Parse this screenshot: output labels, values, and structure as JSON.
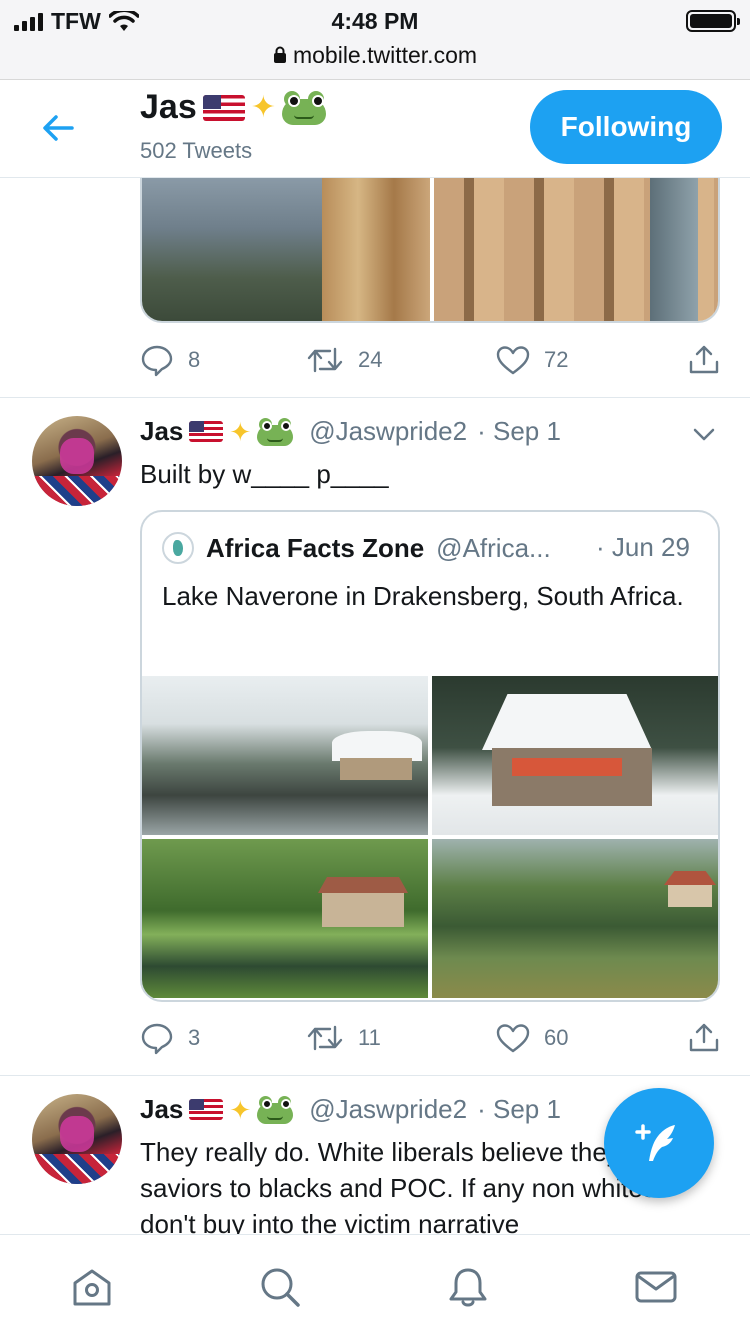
{
  "status_bar": {
    "carrier": "TFW",
    "time": "4:48 PM",
    "url": "mobile.twitter.com"
  },
  "header": {
    "name": "Jas",
    "tweet_count": "502 Tweets",
    "follow_button": "Following"
  },
  "tweets": [
    {
      "actions": {
        "replies": "8",
        "retweets": "24",
        "likes": "72"
      }
    },
    {
      "name": "Jas",
      "handle": "@Jaswpride2",
      "date": "· Sep 1",
      "text": "Built by w____ p____",
      "quote": {
        "name": "Africa Facts Zone",
        "handle": "@Africa...",
        "date": "· Jun 29",
        "text": "Lake Naverone in Drakensberg, South Africa."
      },
      "actions": {
        "replies": "3",
        "retweets": "11",
        "likes": "60"
      }
    },
    {
      "name": "Jas",
      "handle": "@Jaswpride2",
      "date": "· Sep 1",
      "text": "They really do. White liberals believe they are saviors to blacks and POC. If any non whites don't buy into the victim narrative"
    }
  ],
  "colors": {
    "accent": "#1da1f2",
    "text": "#14171a",
    "muted": "#657786",
    "border": "#e1e8ed"
  },
  "icons": {
    "back": "arrow-left-icon",
    "reply": "speech-bubble-icon",
    "retweet": "retweet-icon",
    "like": "heart-icon",
    "share": "share-icon",
    "compose": "feather-icon",
    "nav": [
      "home-icon",
      "search-icon",
      "bell-icon",
      "mail-icon"
    ]
  }
}
